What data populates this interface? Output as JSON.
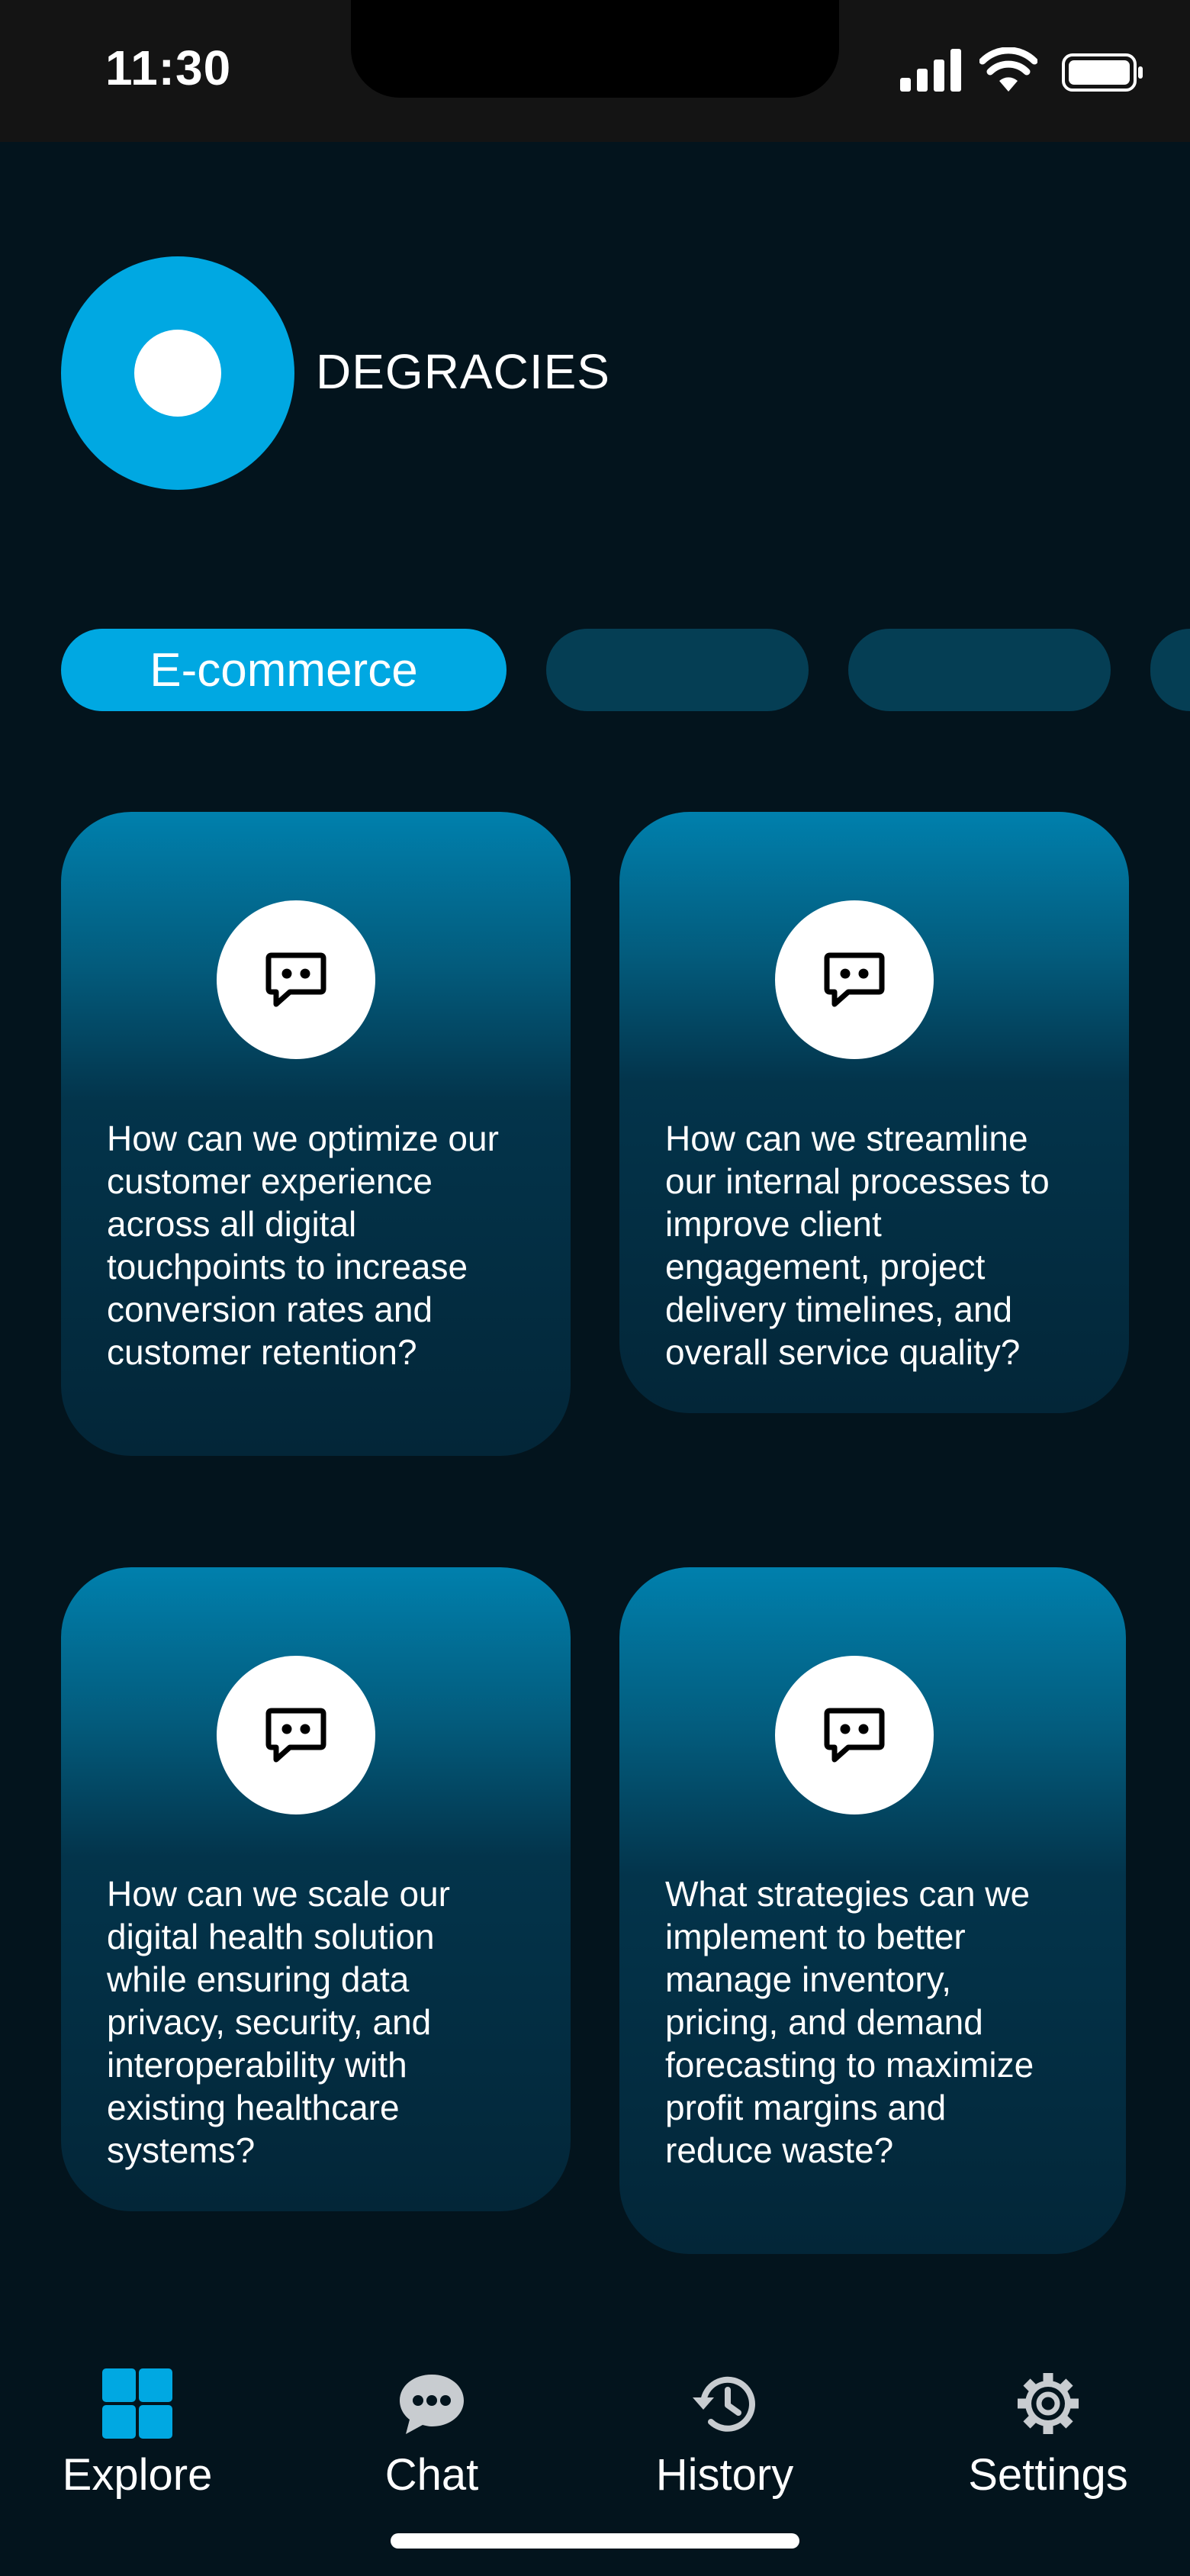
{
  "status_bar": {
    "time": "11:30",
    "icons": [
      "signal-icon",
      "wifi-icon",
      "battery-icon"
    ]
  },
  "header": {
    "brand": "DEGRACIES",
    "logo_color": "#00a8e2"
  },
  "categories": [
    {
      "label": "E-commerce",
      "active": true
    },
    {
      "label": "",
      "active": false
    },
    {
      "label": "",
      "active": false
    },
    {
      "label": "",
      "active": false
    }
  ],
  "prompts": [
    {
      "icon": "chat-bubble-icon",
      "text": "How can we optimize our customer experience across all digital touchpoints to increase conversion rates and customer retention?"
    },
    {
      "icon": "chat-bubble-icon",
      "text": "How can we streamline our internal processes to improve client engagement, project delivery timelines, and overall service quality?"
    },
    {
      "icon": "chat-bubble-icon",
      "text": "How can we scale our digital health solution while ensuring data privacy, security, and interoperability with existing healthcare systems?"
    },
    {
      "icon": "chat-bubble-icon",
      "text": "What strategies can we implement to better manage inventory, pricing, and demand forecasting to maximize profit margins and reduce waste?"
    }
  ],
  "bottom_nav": [
    {
      "label": "Explore",
      "icon": "grid-icon",
      "active": true
    },
    {
      "label": "Chat",
      "icon": "chat-icon",
      "active": false
    },
    {
      "label": "History",
      "icon": "history-icon",
      "active": false
    },
    {
      "label": "Settings",
      "icon": "gear-icon",
      "active": false
    }
  ],
  "colors": {
    "background": "#03141d",
    "accent": "#00a8e2",
    "chip_inactive": "#053e54",
    "icon_muted": "#c8ccd0"
  }
}
